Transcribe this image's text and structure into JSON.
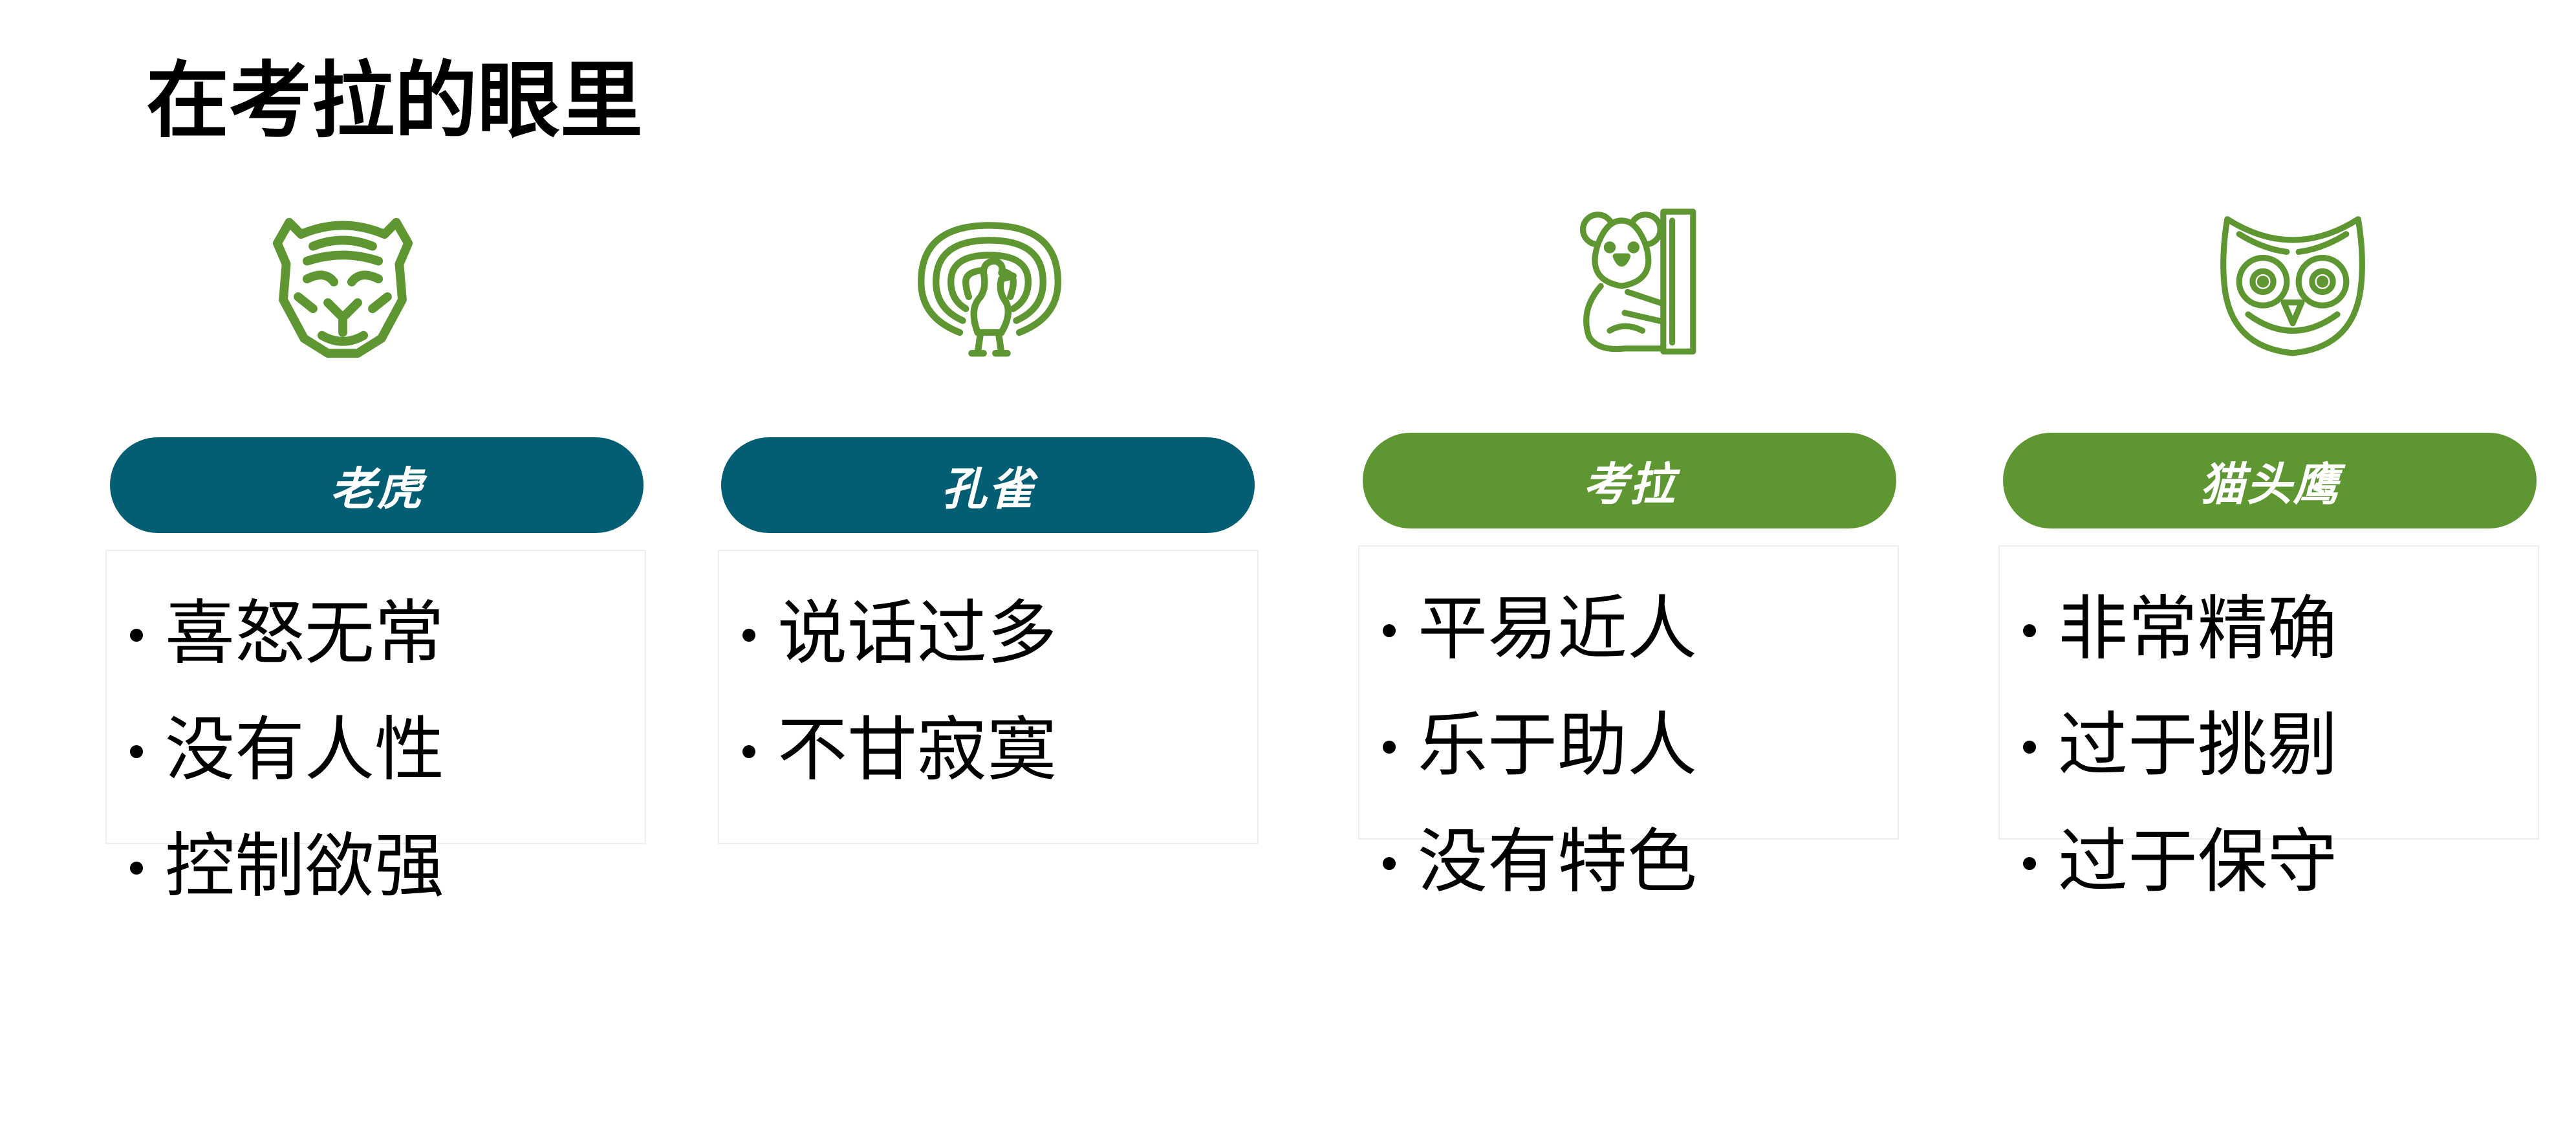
{
  "slide": {
    "title": "在考拉的眼里"
  },
  "colors": {
    "teal": "#045E73",
    "green": "#5E9732",
    "icon_green": "#5E9732"
  },
  "cards": [
    {
      "id": "tiger",
      "icon": "tiger-icon",
      "label": "老虎",
      "color": "#045E73",
      "traits": [
        "喜怒无常",
        "没有人性",
        "控制欲强"
      ]
    },
    {
      "id": "peacock",
      "icon": "peacock-icon",
      "label": "孔雀",
      "color": "#045E73",
      "traits": [
        "说话过多",
        "不甘寂寞"
      ]
    },
    {
      "id": "koala",
      "icon": "koala-icon",
      "label": "考拉",
      "color": "#5E9732",
      "traits": [
        "平易近人",
        "乐于助人",
        "没有特色"
      ]
    },
    {
      "id": "owl",
      "icon": "owl-icon",
      "label": "猫头鹰",
      "color": "#5E9732",
      "traits": [
        "非常精确",
        "过于挑剔",
        "过于保守"
      ]
    }
  ]
}
